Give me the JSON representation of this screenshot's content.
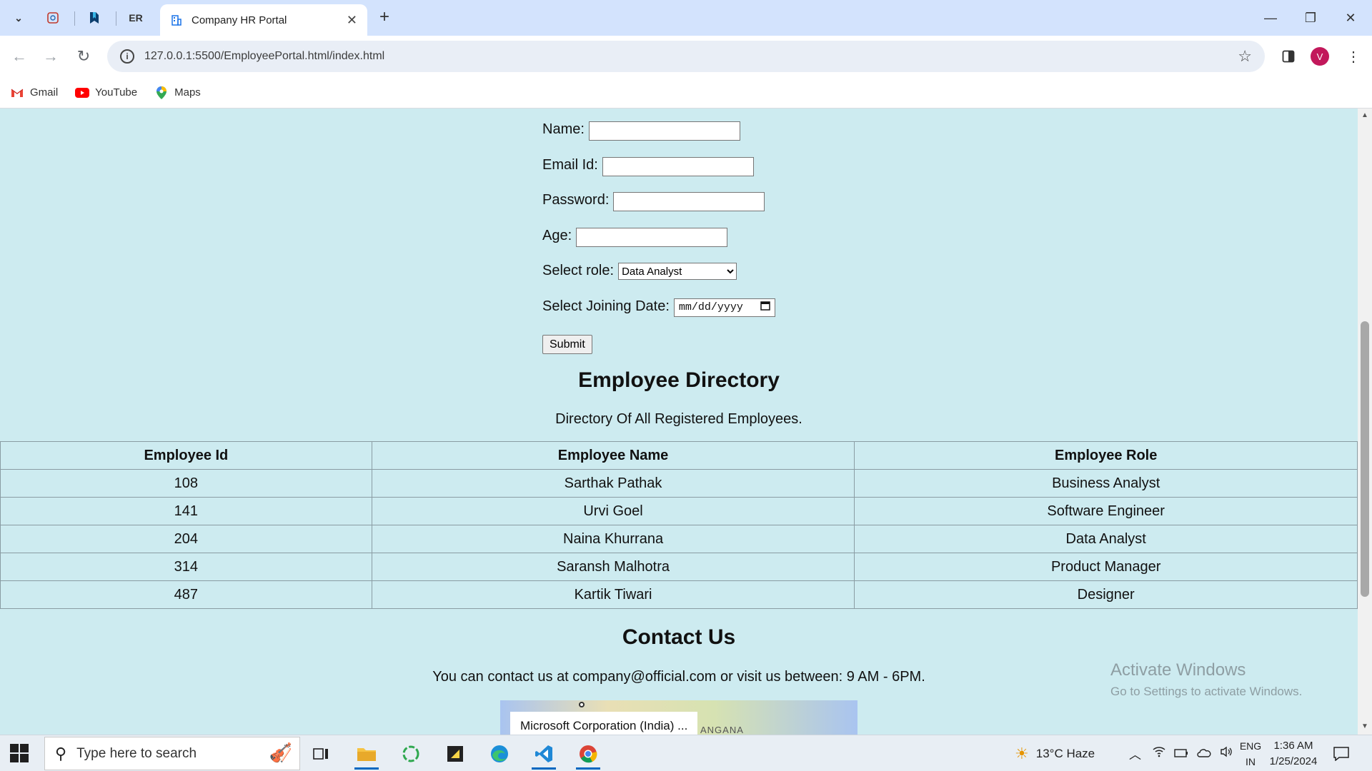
{
  "browser": {
    "tabs": [
      {
        "icon": "history-tab-icon"
      },
      {
        "icon": "bookmark-tab-icon"
      },
      {
        "label": "ER"
      },
      {
        "title": "Company HR Portal",
        "active": true
      }
    ],
    "url": "127.0.0.1:5500/EmployeePortal.html/index.html",
    "profile_initial": "V",
    "bookmarks": [
      {
        "label": "Gmail",
        "icon": "gmail-icon"
      },
      {
        "label": "YouTube",
        "icon": "youtube-icon"
      },
      {
        "label": "Maps",
        "icon": "maps-icon"
      }
    ]
  },
  "form": {
    "name_label": "Name:",
    "email_label": "Email Id:",
    "password_label": "Password:",
    "age_label": "Age:",
    "role_label": "Select role:",
    "role_value": "Data Analyst",
    "date_label": "Select Joining Date:",
    "date_placeholder": "mm/dd/yyyy",
    "submit_label": "Submit"
  },
  "directory": {
    "title": "Employee Directory",
    "subtitle": "Directory Of All Registered Employees.",
    "headers": [
      "Employee Id",
      "Employee Name",
      "Employee Role"
    ],
    "rows": [
      [
        "108",
        "Sarthak Pathak",
        "Business Analyst"
      ],
      [
        "141",
        "Urvi Goel",
        "Software Engineer"
      ],
      [
        "204",
        "Naina Khurrana",
        "Data Analyst"
      ],
      [
        "314",
        "Saransh Malhotra",
        "Product Manager"
      ],
      [
        "487",
        "Kartik Tiwari",
        "Designer"
      ]
    ]
  },
  "contact": {
    "title": "Contact Us",
    "text": "You can contact us at company@official.com or visit us between: 9 AM - 6PM.",
    "map_place": "Microsoft Corporation (India) ...",
    "map_label": "ANGANA"
  },
  "watermark": {
    "line1": "Activate Windows",
    "line2": "Go to Settings to activate Windows."
  },
  "taskbar": {
    "search_placeholder": "Type here to search",
    "weather": "13°C  Haze",
    "lang_line1": "ENG",
    "lang_line2": "IN",
    "time": "1:36 AM",
    "date": "1/25/2024"
  }
}
